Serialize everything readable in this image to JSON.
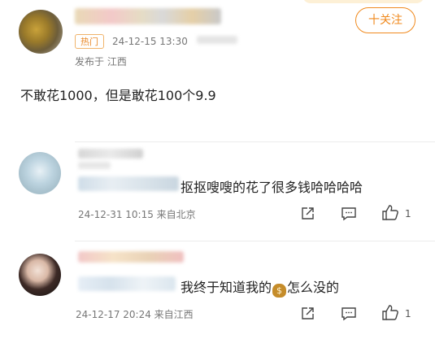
{
  "post": {
    "hot_badge": "热门",
    "timestamp": "24-12-15 13:30",
    "location": "发布于 江西",
    "follow_label": "十关注",
    "text": "不敢花1000，但是敢花100个9.9"
  },
  "comments": [
    {
      "text": "抠抠嗖嗖的花了很多钱哈哈哈哈",
      "meta": "24-12-31 10:15  来自北京",
      "like_count": "1"
    },
    {
      "text_before": "我终于知道我的",
      "emoji": "money-bag",
      "emoji_symbol": "$",
      "text_after": "怎么没的",
      "meta": "24-12-17 20:24  来自江西",
      "like_count": "1"
    }
  ],
  "colors": {
    "accent": "#f08a1e",
    "badge": "#e98a2a",
    "meta": "#777777",
    "icon": "#444444"
  }
}
